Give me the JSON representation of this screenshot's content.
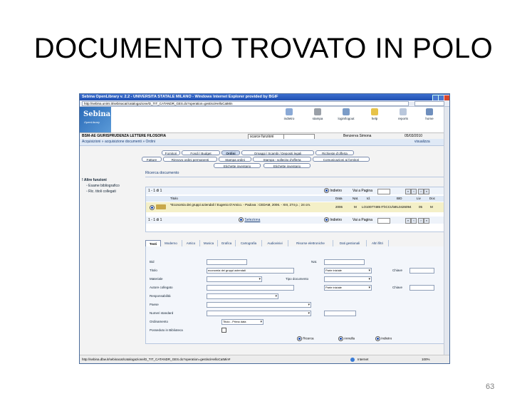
{
  "slide": {
    "title": "DOCUMENTO TROVATO IN POLO",
    "page_number": "63"
  },
  "browser": {
    "window_title": "Sebina OpenLibrary v. 2.2 - UNIVERSITA STATALE MILANO - Windows Internet Explorer provided by BGIF",
    "address": "http://sebina.unimi.it/sebinacat/catalogazione/D_TIT_CATANDR_GES.do?operation=gestisciHelloCatMin",
    "status_url": "http://sebina.dbw.it/sebinacat/catalogazione/D_TIT_CATANDR_GES.do?operation=gestisciHelloCatMin#",
    "status_zone": "Internet",
    "zoom": "100%"
  },
  "app": {
    "logo_main": "Sebina",
    "logo_sub": "OpenLibrary",
    "toolbar": [
      {
        "label": "indietro",
        "icon": "back-icon"
      },
      {
        "label": "stampa",
        "icon": "print-icon"
      },
      {
        "label": "login/logout",
        "icon": "login-icon"
      },
      {
        "label": "help",
        "icon": "help-icon"
      },
      {
        "label": "reports",
        "icon": "reports-icon"
      },
      {
        "label": "home",
        "icon": "home-icon"
      }
    ],
    "info": {
      "library": "BSM-AE GIURISPRUDENZA LETTERE FILOSOFIA",
      "scarce_label": "scarce funzioni",
      "user": "Benzerva Simona",
      "date": "05/03/2010"
    },
    "breadcrumb": "Acquisizioni » acquisizione documenti » Ordini",
    "visualizza": "visualizza",
    "nav_row1": [
      "Fornitori",
      "Fondi / Budget",
      "Ordini",
      "Omaggi / Scambi / Depositi legali",
      "Richieste d'offerta"
    ],
    "nav_row2": [
      "Fatture",
      "Rinnovo ordini permanenti",
      "Stampa ordini",
      "Stampa - sollecito d'offerta",
      "Comunicazioni ai fornitori"
    ],
    "nav_row3": [
      "Etichette inventario",
      "Etichette inventario"
    ],
    "active_nav": "Ordini",
    "sidebar": {
      "header": "Altre funzioni",
      "items": [
        "Esame bibliografico",
        "Ric. titoli collegati"
      ]
    },
    "main_title": "Ricerca documento",
    "results": {
      "counter": "1 - 1 di 1",
      "radio_back": "Indietro",
      "radio_page": "Vai a Pagina",
      "columns": [
        "Titolo",
        "Data",
        "Nat.",
        "Id.",
        "BID",
        "Liv",
        "Doc"
      ],
      "row": {
        "title": "*Economia dei gruppi aziendali / Eugenio D'Amico. - Padova : CEDAM, 2006. - XIII, 274 p. ; 24 cm.",
        "date": "2006",
        "nat": "M",
        "id": "LO10077485",
        "bid": "IT\\ICCU\\MIL0426094",
        "liv": "05",
        "doc": "M"
      },
      "footer_counter": "1 - 1 di 1",
      "footer_link": "Seleziona",
      "footer_back": "Indietro",
      "footer_page": "Vai a Pagina"
    },
    "tabs": [
      "Testi",
      "Moderno",
      "Antico",
      "Musica",
      "Grafica",
      "Cartografia",
      "Audiovisivi",
      "Risorse elettroniche",
      "Dati gestionali",
      "Altri filtri"
    ],
    "active_tab": "Testi",
    "form": {
      "fields": [
        {
          "label": "Bid",
          "value": ""
        },
        {
          "label": "Titolo",
          "value": "economia dei gruppi aziendali"
        },
        {
          "label": "Materiale",
          "value": ""
        },
        {
          "label": "Autore collegato",
          "value": ""
        },
        {
          "label": "Responsabilità",
          "value": ""
        },
        {
          "label": "Paese",
          "value": ""
        },
        {
          "label": "Numeri standard",
          "value": ""
        },
        {
          "label": "Ordinamento",
          "value": "Titolo - Prima data"
        },
        {
          "label": "Posseduto in Biblioteca",
          "value": ""
        }
      ],
      "nat_label": "Nat.",
      "tipo_doc_label": "Tipo documento",
      "parte_iniziale_1": "Parte iniziale",
      "parte_iniziale_2": "Parte iniziale",
      "chiave1": "Chiave",
      "chiave2": "Chiave",
      "actions": [
        "Ricerca",
        "Annulla",
        "Indietro"
      ]
    }
  }
}
